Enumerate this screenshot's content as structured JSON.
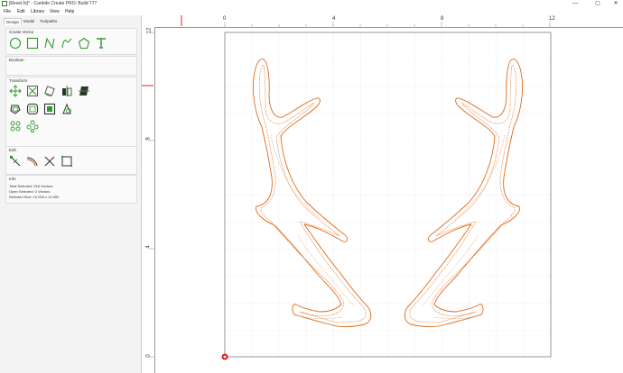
{
  "window": {
    "title": "[Reset.fz]* - Carbide Create PRO: Build 777",
    "minimize": "—",
    "maximize": "▢",
    "close": "✕"
  },
  "menu": {
    "file": "File",
    "edit": "Edit",
    "library": "Library",
    "view": "View",
    "help": "Help"
  },
  "tabs": {
    "design": "Design",
    "model": "Model",
    "toolpaths": "Toolpaths"
  },
  "panels": {
    "create_vector": "Create Vector",
    "boolean": "Boolean",
    "transform": "Transform",
    "edit": "Edit",
    "info": "Info"
  },
  "info": {
    "total_selected": "Total Selected:  518 Vectors",
    "open_selected": "Open Selected:  0 Vectors",
    "selected_size": "Selected Size:     10.000 x 10.052"
  },
  "rulers": {
    "top": [
      "0",
      "4",
      "8",
      "12"
    ],
    "left": [
      "12",
      "8",
      "4",
      "0"
    ]
  },
  "colors": {
    "accent": "#33aa33",
    "vector": "#e06a1a",
    "ruler_marker": "#e02020"
  },
  "icons": [
    "circle-tool-icon",
    "rectangle-tool-icon",
    "curve-tool-icon",
    "polyline-tool-icon",
    "polygon-tool-icon",
    "text-tool-icon",
    "move-icon",
    "scale-icon",
    "rotate-icon",
    "mirror-icon",
    "skew-icon",
    "offset-icon",
    "join-icon",
    "boundary-icon",
    "node-edit-icon",
    "align-icon",
    "array-icon",
    "node-tool-icon",
    "fillet-icon",
    "trim-icon",
    "box-icon"
  ]
}
